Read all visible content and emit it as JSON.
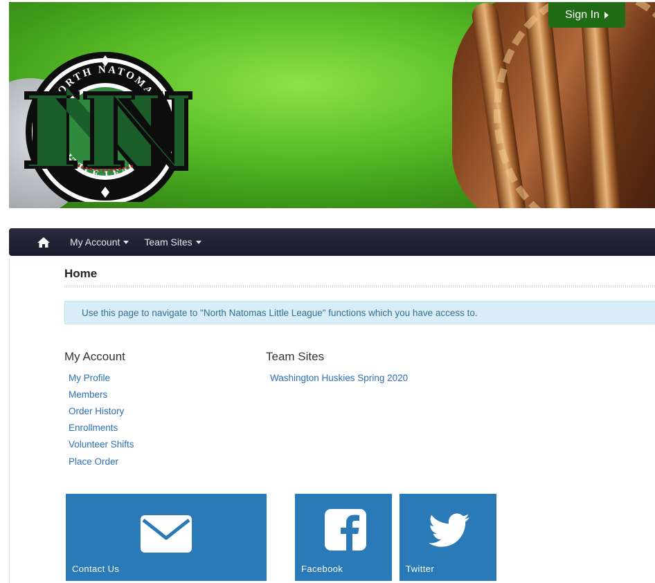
{
  "header": {
    "sign_in_label": "Sign In",
    "logo": {
      "ring_text_top": "NORTH NATOMAS",
      "ring_text_bottom": "LITTLE LEAGUE",
      "monogram": "NN"
    }
  },
  "navbar": {
    "items": [
      {
        "label": "My Account"
      },
      {
        "label": "Team Sites"
      }
    ]
  },
  "page": {
    "title": "Home",
    "alert_text": "Use this page to navigate to \"North Natomas Little League\" functions which you have access to."
  },
  "my_account": {
    "heading": "My Account",
    "links": [
      "My Profile",
      "Members",
      "Order History",
      "Enrollments",
      "Volunteer Shifts",
      "Place Order"
    ]
  },
  "team_sites": {
    "heading": "Team Sites",
    "links": [
      "Washington Huskies Spring 2020"
    ]
  },
  "tiles": [
    {
      "label": "Contact Us",
      "icon": "envelope-icon"
    },
    {
      "label": "Facebook",
      "icon": "facebook-icon"
    },
    {
      "label": "Twitter",
      "icon": "twitter-icon"
    }
  ],
  "colors": {
    "navbar": "#1f1f30",
    "sign_in": "#1f6b16",
    "link": "#2a6fb8",
    "tile": "#2a7ab7",
    "alert_bg": "#d9edf7",
    "alert_text": "#31708f",
    "logo_green": "#1b5e2c"
  }
}
